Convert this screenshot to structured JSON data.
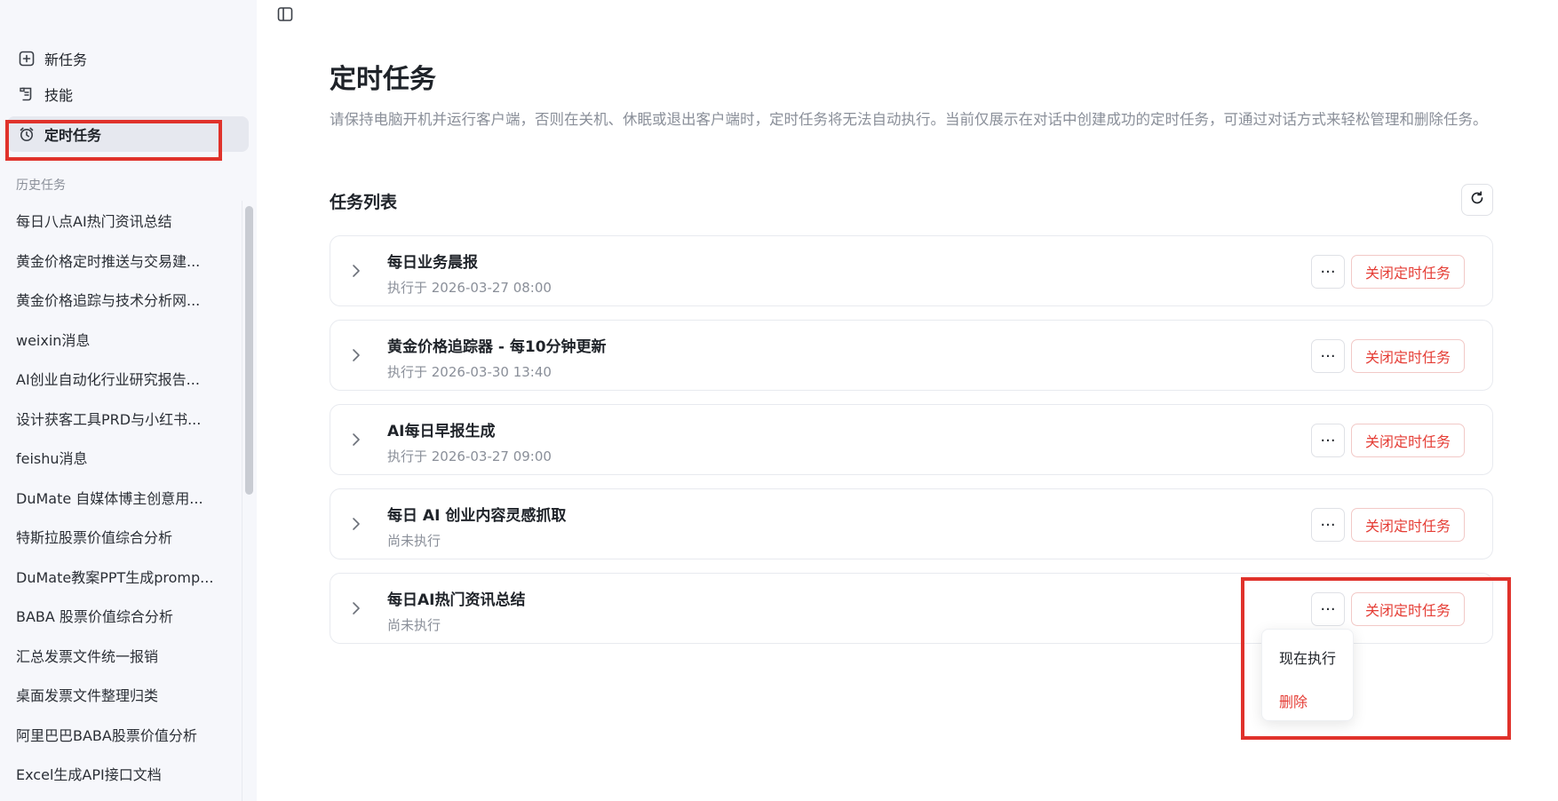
{
  "sidebar": {
    "nav": [
      {
        "label": "新任务",
        "icon": "new-task-icon"
      },
      {
        "label": "技能",
        "icon": "skill-icon"
      },
      {
        "label": "定时任务",
        "icon": "alarm-clock-icon"
      }
    ],
    "history_title": "历史任务",
    "history": [
      "每日八点AI热门资讯总结",
      "黄金价格定时推送与交易建...",
      "黄金价格追踪与技术分析网...",
      "weixin消息",
      "AI创业自动化行业研究报告...",
      "设计获客工具PRD与小红书...",
      "feishu消息",
      "DuMate 自媒体博主创意用...",
      "特斯拉股票价值综合分析",
      "DuMate教案PPT生成promp...",
      "BABA 股票价值综合分析",
      "汇总发票文件统一报销",
      "桌面发票文件整理归类",
      "阿里巴巴BABA股票价值分析",
      "Excel生成API接口文档"
    ]
  },
  "main": {
    "title": "定时任务",
    "description": "请保持电脑开机并运行客户端，否则在关机、休眠或退出客户端时，定时任务将无法自动执行。当前仅展示在对话中创建成功的定时任务，可通过对话方式来轻松管理和删除任务。",
    "list_title": "任务列表",
    "more_label": "···",
    "close_label": "关闭定时任务",
    "tasks": [
      {
        "name": "每日业务晨报",
        "status": "执行于 2026-03-27 08:00"
      },
      {
        "name": "黄金价格追踪器 - 每10分钟更新",
        "status": "执行于 2026-03-30 13:40"
      },
      {
        "name": "AI每日早报生成",
        "status": "执行于 2026-03-27 09:00"
      },
      {
        "name": "每日 AI 创业内容灵感抓取",
        "status": "尚未执行"
      },
      {
        "name": "每日AI热门资讯总结",
        "status": "尚未执行"
      }
    ],
    "dropdown": {
      "run_now": "现在执行",
      "delete": "删除"
    }
  },
  "colors": {
    "accent_red": "#e53d35",
    "highlight_box": "#e0322b",
    "sidebar_bg": "#f6f7fb"
  }
}
